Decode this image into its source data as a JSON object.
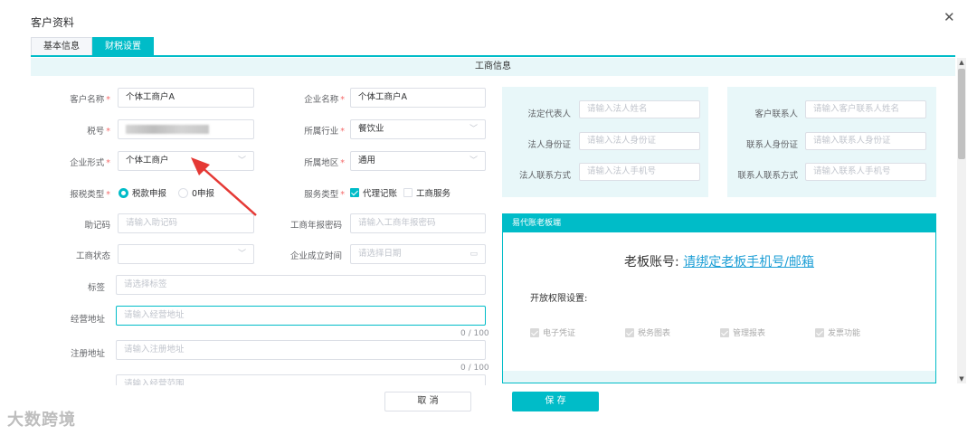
{
  "dialog": {
    "title": "客户资料",
    "close_icon": "close-icon"
  },
  "tabs": [
    {
      "label": "基本信息",
      "active": false
    },
    {
      "label": "财税设置",
      "active": true
    }
  ],
  "section_title": "工商信息",
  "left_form": {
    "customer_name": {
      "label": "客户名称",
      "value": "个体工商户A"
    },
    "company_name": {
      "label": "企业名称",
      "value": "个体工商户A"
    },
    "tax_no": {
      "label": "税号"
    },
    "industry": {
      "label": "所属行业",
      "value": "餐饮业"
    },
    "company_form": {
      "label": "企业形式",
      "value": "个体工商户"
    },
    "region": {
      "label": "所属地区",
      "value": "通用"
    },
    "tax_type": {
      "label": "报税类型",
      "options": [
        "税款申报",
        "0申报"
      ],
      "selected": "税款申报"
    },
    "service_type": {
      "label": "服务类型",
      "options": [
        {
          "label": "代理记账",
          "checked": true
        },
        {
          "label": "工商服务",
          "checked": false
        }
      ]
    },
    "mnemonic": {
      "label": "助记码",
      "placeholder": "请输入助记码"
    },
    "annual_pwd": {
      "label": "工商年报密码",
      "placeholder": "请输入工商年报密码"
    },
    "biz_status": {
      "label": "工商状态",
      "value": ""
    },
    "found_date": {
      "label": "企业成立时间",
      "placeholder": "请选择日期"
    },
    "tags": {
      "label": "标签",
      "placeholder": "请选择标签"
    },
    "biz_address": {
      "label": "经营地址",
      "placeholder": "请输入经营地址",
      "counter": "0 / 100"
    },
    "reg_address": {
      "label": "注册地址",
      "placeholder": "请输入注册地址",
      "counter": "0 / 100"
    },
    "biz_scope": {
      "placeholder": "请输入经营范围"
    }
  },
  "legal_panel": {
    "rep": {
      "label": "法定代表人",
      "placeholder": "请输入法人姓名"
    },
    "id": {
      "label": "法人身份证",
      "placeholder": "请输入法人身份证"
    },
    "phone": {
      "label": "法人联系方式",
      "placeholder": "请输入法人手机号"
    }
  },
  "contact_panel": {
    "name": {
      "label": "客户联系人",
      "placeholder": "请输入客户联系人姓名"
    },
    "id": {
      "label": "联系人身份证",
      "placeholder": "请输入联系人身份证"
    },
    "phone": {
      "label": "联系人联系方式",
      "placeholder": "请输入联系人手机号"
    }
  },
  "boss_panel": {
    "header": "易代账老板端",
    "account_label": "老板账号:",
    "account_link": "请绑定老板手机号/邮箱",
    "perm_label": "开放权限设置:",
    "perms": [
      "电子凭证",
      "税务图表",
      "管理报表",
      "发票功能"
    ]
  },
  "footer": {
    "cancel": "取 消",
    "save": "保 存"
  },
  "watermark": "大数跨境",
  "colors": {
    "accent": "#00bcc8",
    "panel_bg": "#e8f7f9",
    "required": "#f56c6c",
    "annotation_arrow": "#e53935"
  }
}
